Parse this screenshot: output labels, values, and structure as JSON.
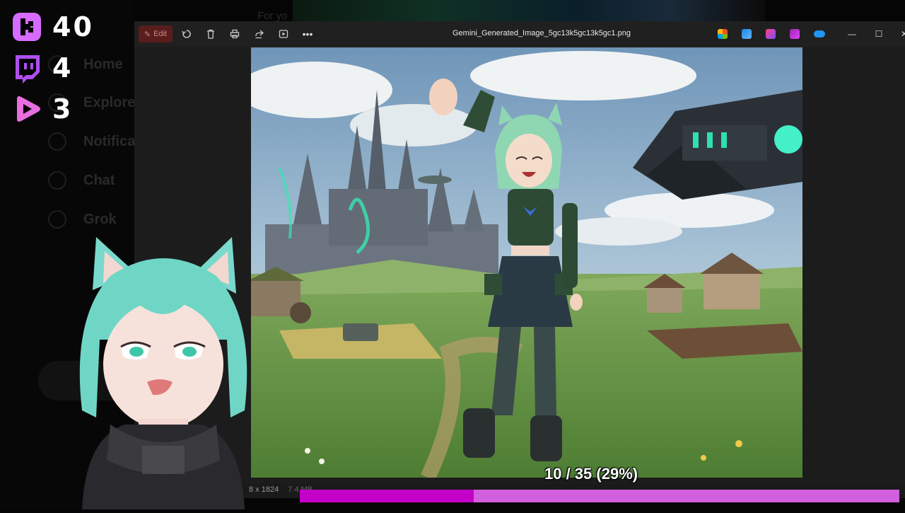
{
  "background_sidebar": {
    "items": [
      {
        "label": "Home"
      },
      {
        "label": "Explore"
      },
      {
        "label": "Notifications"
      },
      {
        "label": "Chat"
      },
      {
        "label": "Grok"
      }
    ],
    "top_text": "For yo"
  },
  "viewer": {
    "edit_label": "Edit",
    "filename": "Gemini_Generated_Image_5gc13k5gc13k5gc1.png",
    "dimensions": "8 x 1824",
    "size_text": "7.4 MB",
    "accent_edit": "#5a1d1d"
  },
  "progress": {
    "label": "10 / 35 (29%)",
    "current": 10,
    "total": 35,
    "fraction": 0.29,
    "fill_color": "#c400c8",
    "track_color": "#d25fde"
  },
  "stream_counters": [
    {
      "platform": "kick",
      "icon": "kick-logo-icon",
      "count": "40",
      "color": "#d56bff"
    },
    {
      "platform": "twitch",
      "icon": "twitch-logo-icon",
      "count": "4",
      "color": "#b04ff0"
    },
    {
      "platform": "rumble",
      "icon": "play-logo-icon",
      "count": "3",
      "color": "#e86ee0"
    }
  ]
}
